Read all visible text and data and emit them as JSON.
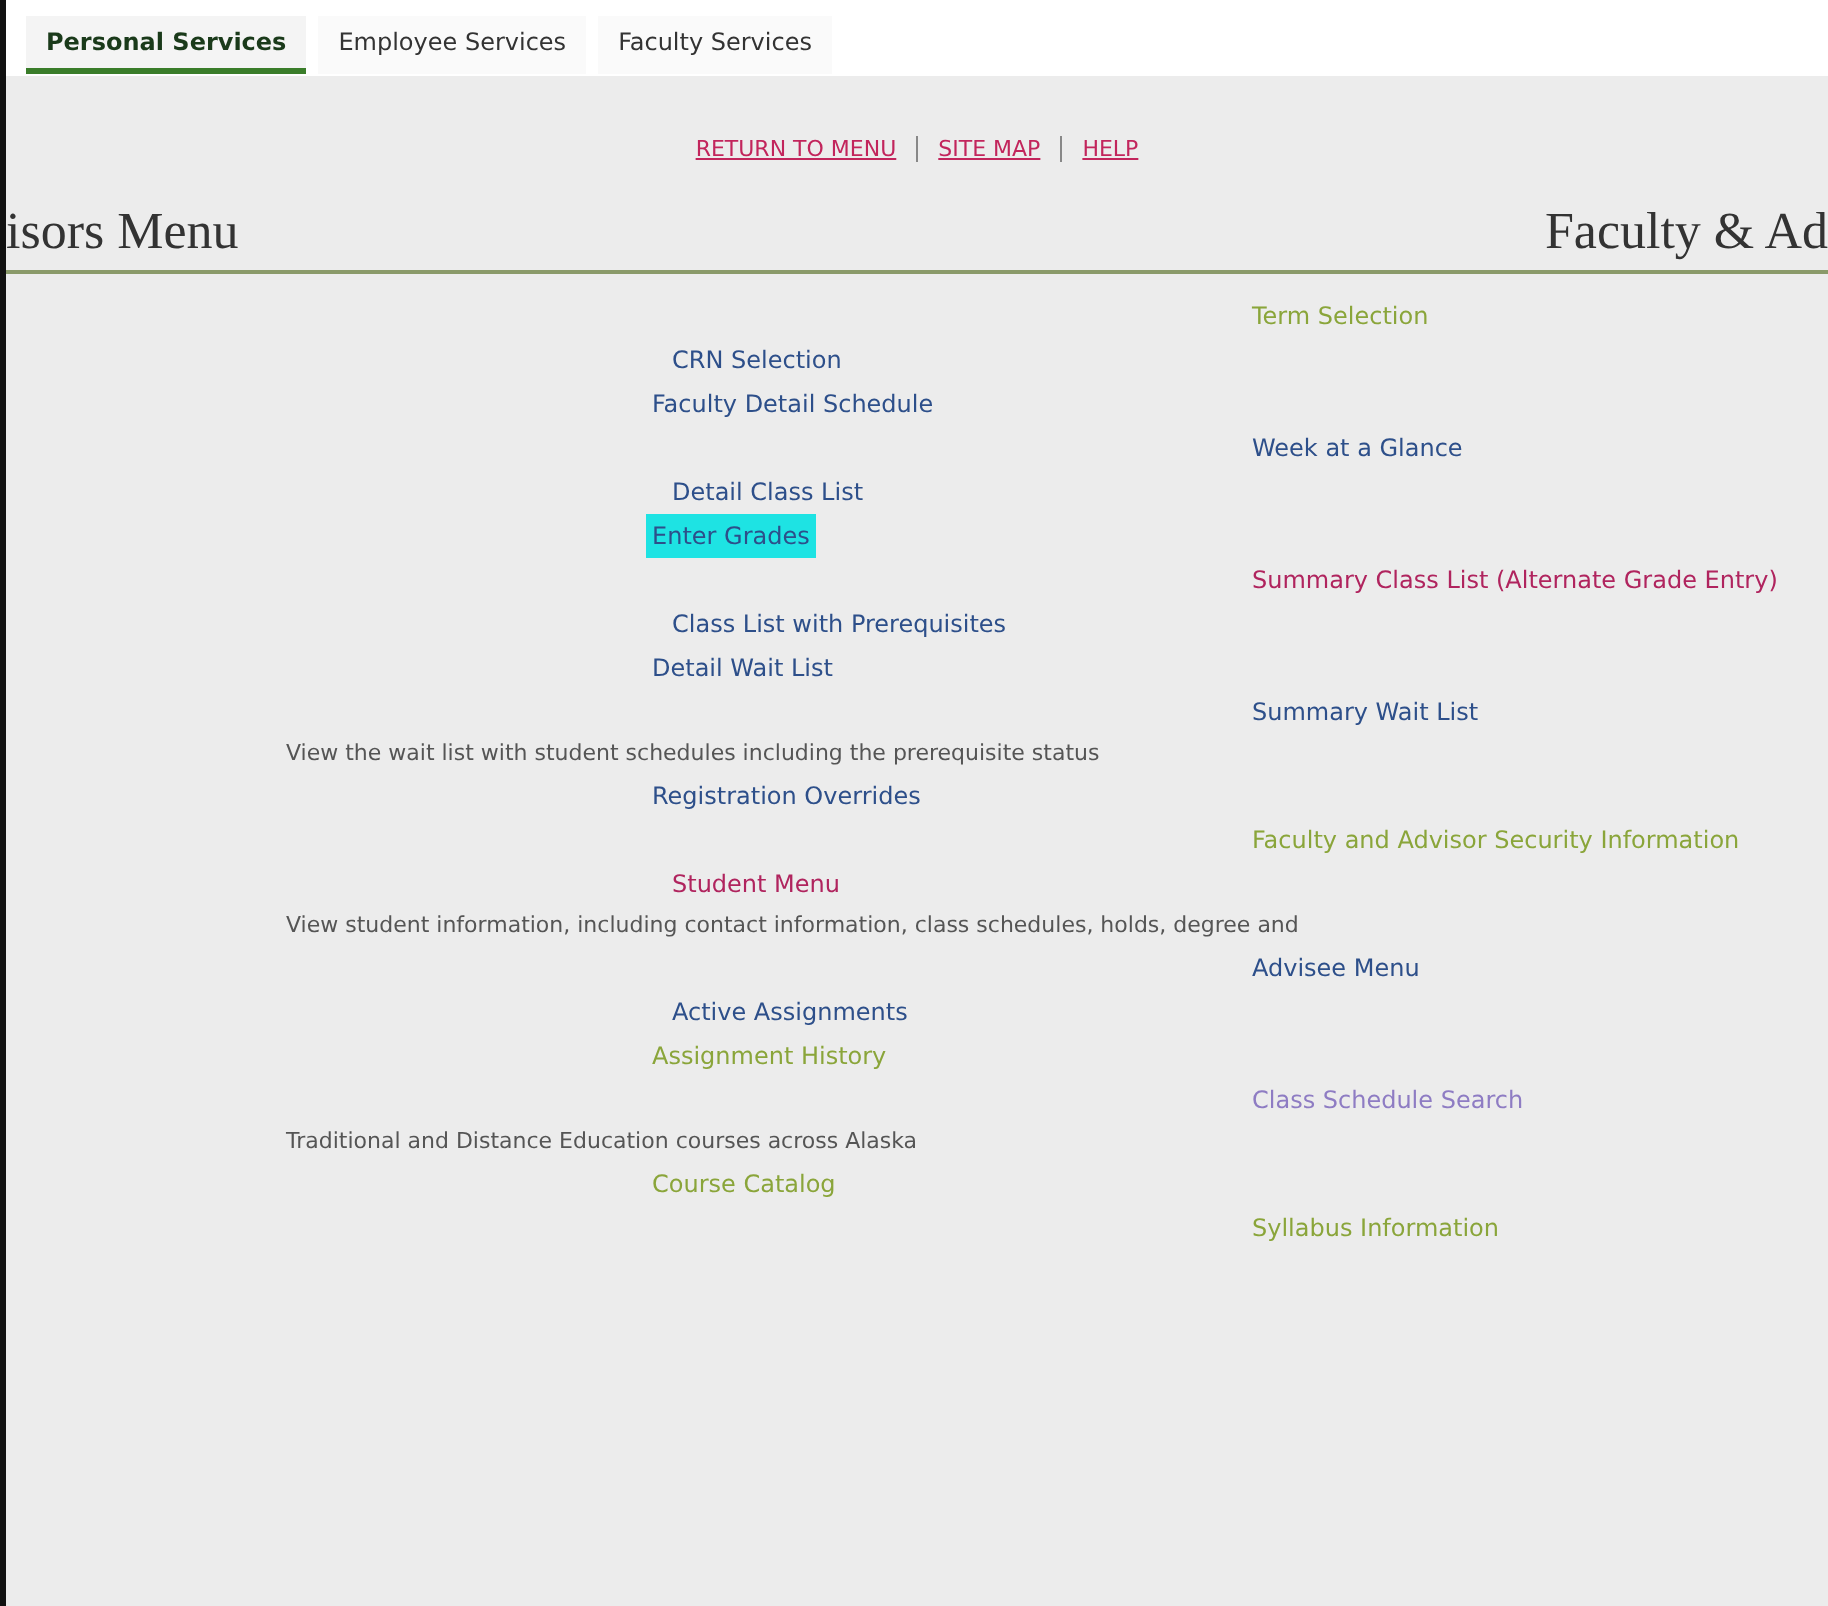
{
  "tabs": [
    {
      "label": "Personal Services",
      "selected": true
    },
    {
      "label": "Employee Services",
      "selected": false
    },
    {
      "label": "Faculty Services",
      "selected": false
    }
  ],
  "top_links": [
    "RETURN TO MENU",
    "SITE MAP",
    "HELP"
  ],
  "title_left": "isors Menu",
  "title_right": "Faculty & Ad",
  "menu": [
    {
      "kind": "link",
      "label": "Term Selection",
      "color": "#8aa53a",
      "highlighted": false
    },
    {
      "kind": "link",
      "label": "CRN Selection",
      "color": "#2d4f8a",
      "highlighted": false
    },
    {
      "kind": "link",
      "label": "Faculty Detail Schedule",
      "color": "#2d4f8a",
      "highlighted": false
    },
    {
      "kind": "link",
      "label": "Week at a Glance",
      "color": "#2d4f8a",
      "highlighted": false
    },
    {
      "kind": "link",
      "label": "Detail Class List",
      "color": "#2d4f8a",
      "highlighted": false
    },
    {
      "kind": "link",
      "label": "Enter Grades",
      "highlighted": true
    },
    {
      "kind": "link",
      "label": "Summary Class List (Alternate Grade Entry)",
      "color": "#b0245e",
      "highlighted": false
    },
    {
      "kind": "link",
      "label": "Class List with Prerequisites",
      "color": "#2d4f8a",
      "highlighted": false
    },
    {
      "kind": "link",
      "label": "Detail Wait List",
      "color": "#2d4f8a",
      "highlighted": false
    },
    {
      "kind": "link",
      "label": "Summary Wait List",
      "color": "#2d4f8a",
      "highlighted": false
    },
    {
      "kind": "desc",
      "label": "View the wait list with student schedules including the prerequisite status"
    },
    {
      "kind": "link",
      "label": "Registration Overrides",
      "color": "#2d4f8a",
      "highlighted": false
    },
    {
      "kind": "link",
      "label": "Faculty and Advisor Security Information",
      "color": "#8aa53a",
      "highlighted": false
    },
    {
      "kind": "link",
      "label": "Student Menu",
      "color": "#b0245e",
      "highlighted": false
    },
    {
      "kind": "desc",
      "label": "View student information, including contact information, class schedules, holds, degree and"
    },
    {
      "kind": "link",
      "label": "Advisee Menu",
      "color": "#2d4f8a",
      "highlighted": false
    },
    {
      "kind": "link",
      "label": "Active Assignments",
      "color": "#2d4f8a",
      "highlighted": false
    },
    {
      "kind": "link",
      "label": "Assignment History",
      "color": "#8aa53a",
      "highlighted": false
    },
    {
      "kind": "link",
      "label": "Class Schedule Search",
      "color": "#8e7cc3",
      "highlighted": false
    },
    {
      "kind": "desc",
      "label": "Traditional and Distance Education courses across Alaska"
    },
    {
      "kind": "link",
      "label": "Course Catalog",
      "color": "#8aa53a",
      "highlighted": false
    },
    {
      "kind": "link",
      "label": "Syllabus Information",
      "color": "#8aa53a",
      "highlighted": false
    }
  ]
}
